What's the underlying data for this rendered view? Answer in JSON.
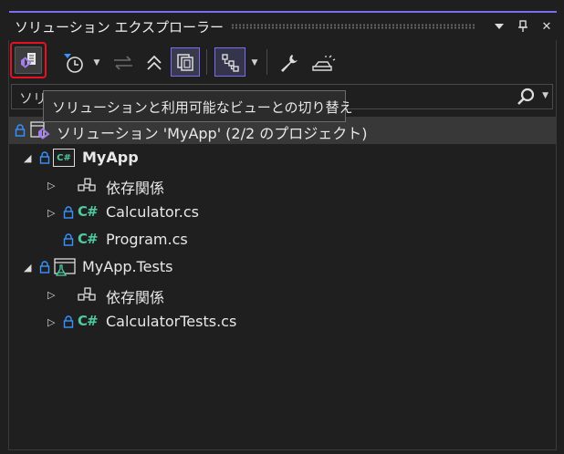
{
  "panel": {
    "title": "ソリューション エクスプローラー",
    "accent_color": "#7c6cf0",
    "buttons": {
      "dropdown_icon": "▾",
      "pin_icon": "pin-icon",
      "close_icon": "✕"
    }
  },
  "toolbar": {
    "switch_views_icon": "visual-studio-icon",
    "history_icon": "pending-changes-filter-icon",
    "sync_icon": "sync-with-active-document-icon",
    "collapse_icon": "collapse-all-icon",
    "show_all_icon": "show-all-files-icon",
    "tree_icon": "tree-view-icon",
    "properties_icon": "wrench-icon",
    "preview_icon": "preview-selected-icon",
    "dropdown_glyph": "▼"
  },
  "search": {
    "value": "ソリ",
    "dropdown_glyph": "▼"
  },
  "tooltip": {
    "text": "ソリューションと利用可能なビューとの切り替え"
  },
  "tree": {
    "solution": {
      "label": "ソリューション 'MyApp' (2/2 のプロジェクト)"
    },
    "projects": [
      {
        "name": "MyApp",
        "lang_badge": "C#",
        "children": [
          {
            "label": "依存関係",
            "kind": "dependencies"
          },
          {
            "label": "Calculator.cs",
            "kind": "cs",
            "badge": "C#"
          },
          {
            "label": "Program.cs",
            "kind": "cs",
            "badge": "C#"
          }
        ]
      },
      {
        "name": "MyApp.Tests",
        "lang_badge": "",
        "children": [
          {
            "label": "依存関係",
            "kind": "dependencies"
          },
          {
            "label": "CalculatorTests.cs",
            "kind": "cs",
            "badge": "C#"
          }
        ]
      }
    ],
    "glyphs": {
      "expanded": "◢",
      "collapsed": "▷"
    }
  }
}
